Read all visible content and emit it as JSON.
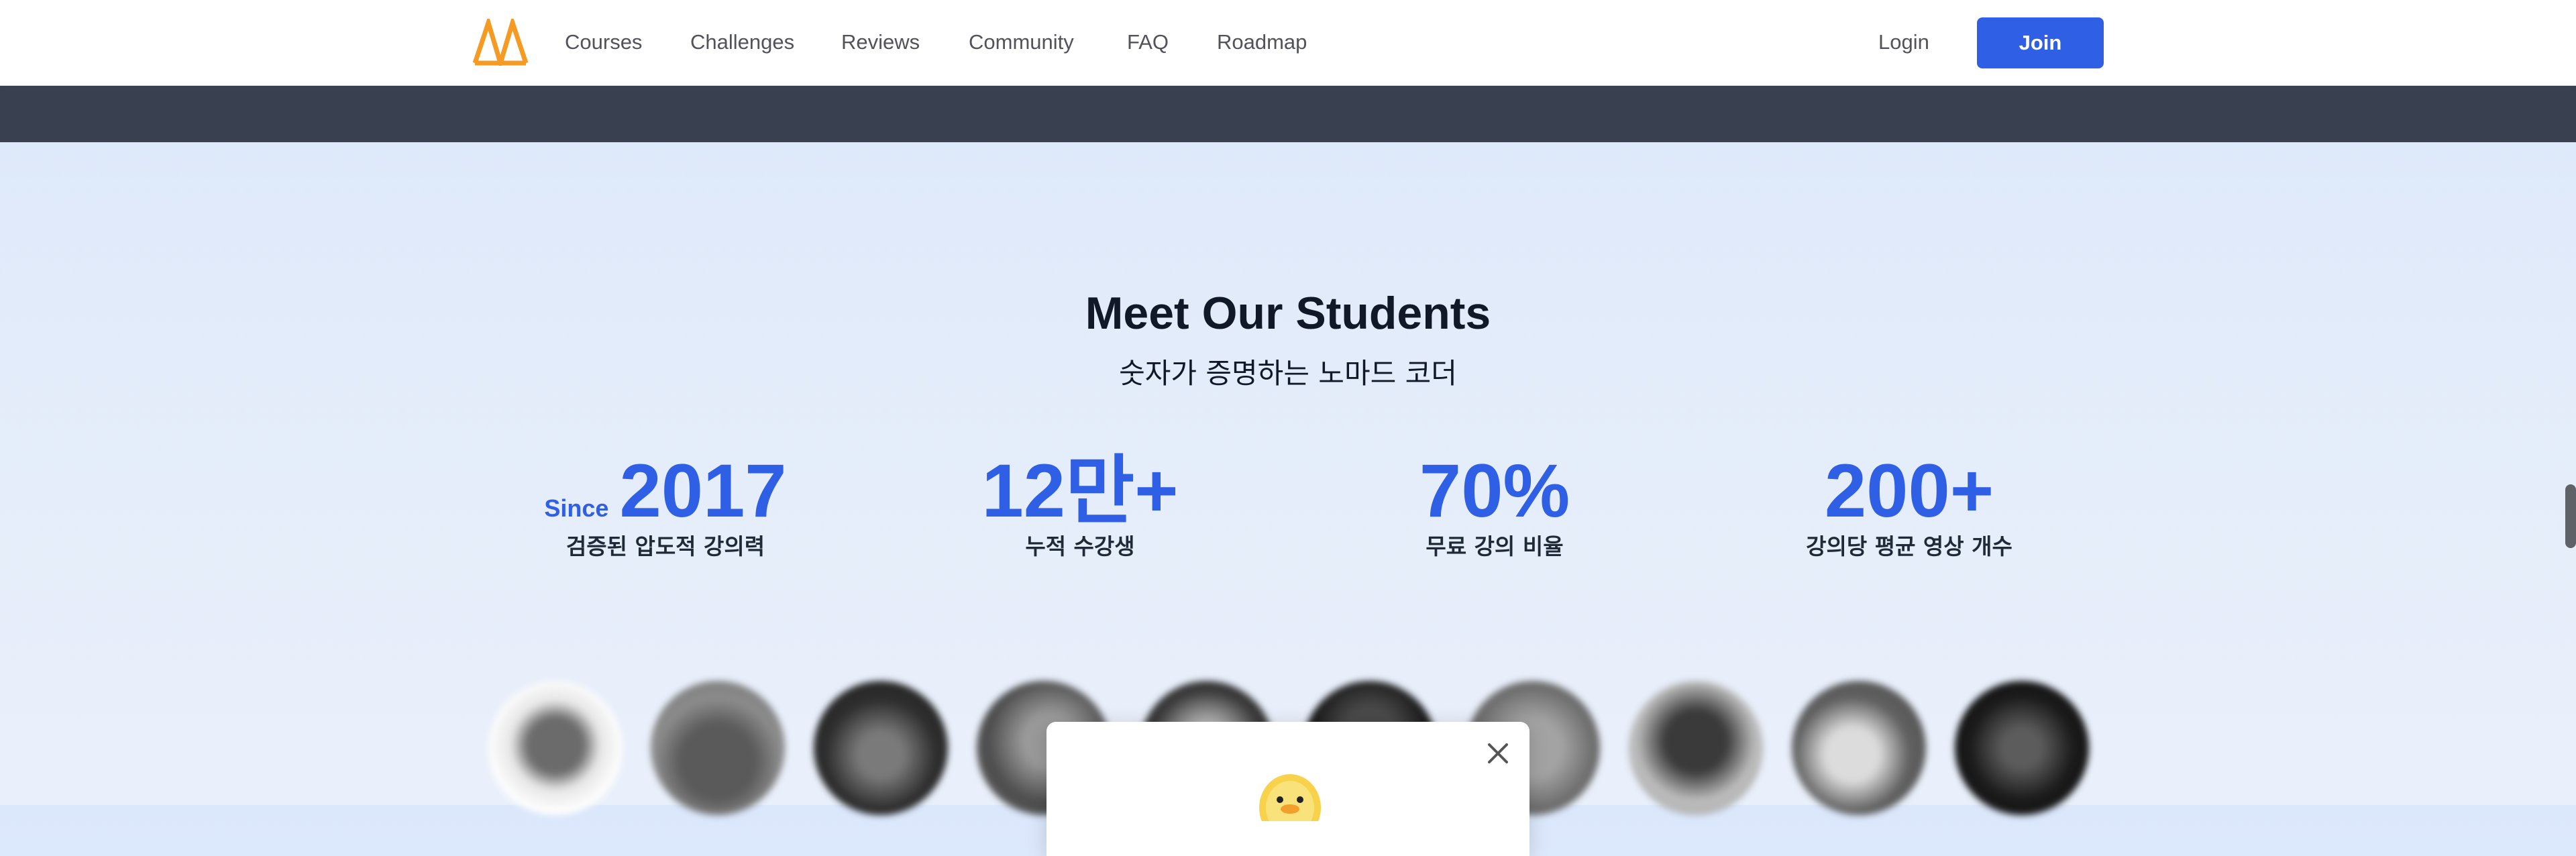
{
  "nav": {
    "brand": "Nomad Coders",
    "links": [
      "Courses",
      "Challenges",
      "Reviews",
      "Community",
      "FAQ",
      "Roadmap"
    ],
    "login_label": "Login",
    "join_label": "Join",
    "logo_color": "#f59a23",
    "join_color": "#2f5fe4"
  },
  "section": {
    "title": "Meet Our Students",
    "subtitle": "숫자가 증명하는 노마드 코더"
  },
  "stats": [
    {
      "prefix": "Since",
      "value": "2017",
      "label": "검증된 압도적 강의력"
    },
    {
      "prefix": "",
      "value": "12만+",
      "label": "누적 수강생"
    },
    {
      "prefix": "",
      "value": "70%",
      "label": "무료 강의 비율"
    },
    {
      "prefix": "",
      "value": "200+",
      "label": "강의당 평균 영상 개수"
    }
  ],
  "avatars_count": 10,
  "popup": {
    "close_icon": "close-icon",
    "mascot_icon": "duck-icon"
  },
  "colors": {
    "accent": "#2f5fe4",
    "dark_band": "#394150"
  }
}
